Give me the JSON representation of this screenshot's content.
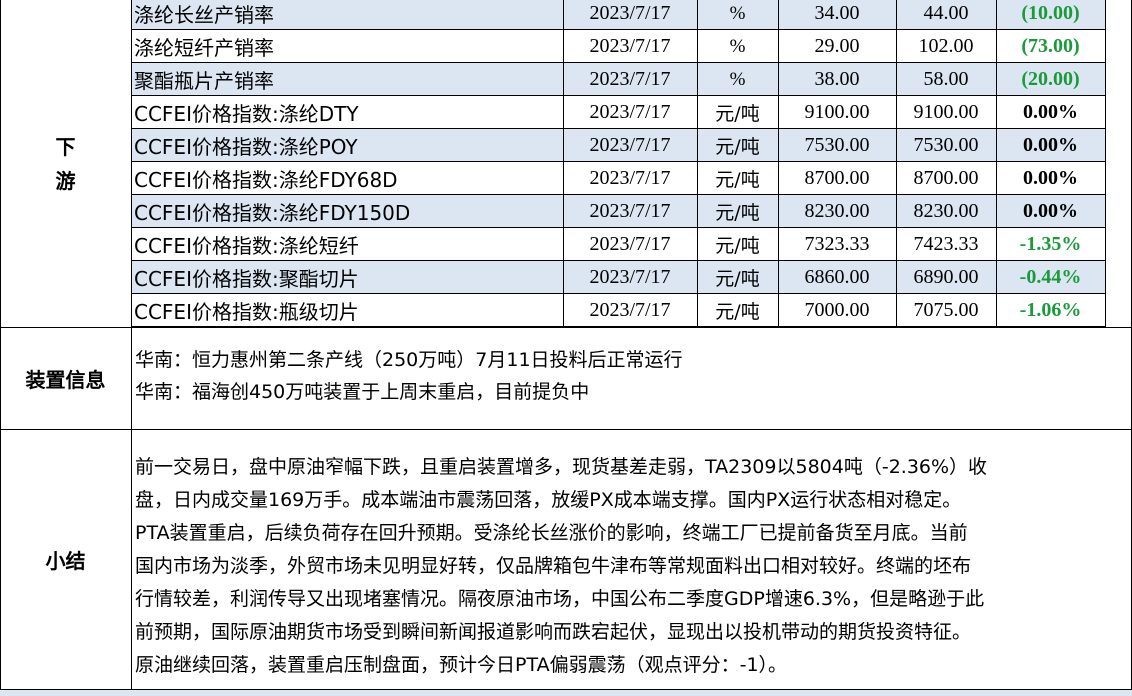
{
  "downstream": {
    "label_line1": "下",
    "label_line2": "游",
    "rows": [
      {
        "name": "涤纶长丝产销率",
        "date": "2023/7/17",
        "unit": "%",
        "prev": "34.00",
        "cur": "44.00",
        "change": "(10.00)",
        "change_color": "#1a9a3a",
        "shaded": true,
        "unit_serif": true
      },
      {
        "name": "涤纶短纤产销率",
        "date": "2023/7/17",
        "unit": "%",
        "prev": "29.00",
        "cur": "102.00",
        "change": "(73.00)",
        "change_color": "#1a9a3a",
        "shaded": false,
        "unit_serif": true
      },
      {
        "name": "聚酯瓶片产销率",
        "date": "2023/7/17",
        "unit": "%",
        "prev": "38.00",
        "cur": "58.00",
        "change": "(20.00)",
        "change_color": "#1a9a3a",
        "shaded": true,
        "unit_serif": true
      },
      {
        "name": "CCFEI价格指数:涤纶DTY",
        "date": "2023/7/17",
        "unit": "元/吨",
        "prev": "9100.00",
        "cur": "9100.00",
        "change": "0.00%",
        "change_color": "#000000",
        "shaded": false,
        "unit_serif": false
      },
      {
        "name": "CCFEI价格指数:涤纶POY",
        "date": "2023/7/17",
        "unit": "元/吨",
        "prev": "7530.00",
        "cur": "7530.00",
        "change": "0.00%",
        "change_color": "#000000",
        "shaded": true,
        "unit_serif": false
      },
      {
        "name": "CCFEI价格指数:涤纶FDY68D",
        "date": "2023/7/17",
        "unit": "元/吨",
        "prev": "8700.00",
        "cur": "8700.00",
        "change": "0.00%",
        "change_color": "#000000",
        "shaded": false,
        "unit_serif": false
      },
      {
        "name": "CCFEI价格指数:涤纶FDY150D",
        "date": "2023/7/17",
        "unit": "元/吨",
        "prev": "8230.00",
        "cur": "8230.00",
        "change": "0.00%",
        "change_color": "#000000",
        "shaded": true,
        "unit_serif": false
      },
      {
        "name": "CCFEI价格指数:涤纶短纤",
        "date": "2023/7/17",
        "unit": "元/吨",
        "prev": "7323.33",
        "cur": "7423.33",
        "change": "-1.35%",
        "change_color": "#1a9a3a",
        "shaded": false,
        "unit_serif": false
      },
      {
        "name": "CCFEI价格指数:聚酯切片",
        "date": "2023/7/17",
        "unit": "元/吨",
        "prev": "6860.00",
        "cur": "6890.00",
        "change": "-0.44%",
        "change_color": "#1a9a3a",
        "shaded": true,
        "unit_serif": false
      },
      {
        "name": "CCFEI价格指数:瓶级切片",
        "date": "2023/7/17",
        "unit": "元/吨",
        "prev": "7000.00",
        "cur": "7075.00",
        "change": "-1.06%",
        "change_color": "#1a9a3a",
        "shaded": false,
        "unit_serif": false
      }
    ]
  },
  "device_info": {
    "label": "装置信息",
    "lines": [
      "华南：恒力惠州第二条产线（250万吨）7月11日投料后正常运行",
      "华南：福海创450万吨装置于上周末重启，目前提负中"
    ]
  },
  "summary": {
    "label": "小结",
    "lines": [
      "前一交易日，盘中原油窄幅下跌，且重启装置增多，现货基差走弱，TA2309以5804吨（-2.36%）收",
      "盘，日内成交量169万手。成本端油市震荡回落，放缓PX成本端支撑。国内PX运行状态相对稳定。",
      "PTA装置重启，后续负荷存在回升预期。受涤纶长丝涨价的影响，终端工厂已提前备货至月底。当前",
      "国内市场为淡季，外贸市场未见明显好转，仅品牌箱包牛津布等常规面料出口相对较好。终端的坯布",
      "行情较差，利润传导又出现堵塞情况。隔夜原油市场，中国公布二季度GDP增速6.3%，但是略逊于此",
      "前预期，国际原油期货市场受到瞬间新闻报道影响而跌宕起伏，显现出以投机带动的期货投资特征。",
      "原油继续回落，装置重启压制盘面，预计今日PTA偏弱震荡（观点评分：-1）。"
    ]
  },
  "colors": {
    "row_shade": "#dce6f2",
    "label_bg": "#ffffff",
    "grid": "#000000",
    "bottom_band": "#dce6f2"
  }
}
